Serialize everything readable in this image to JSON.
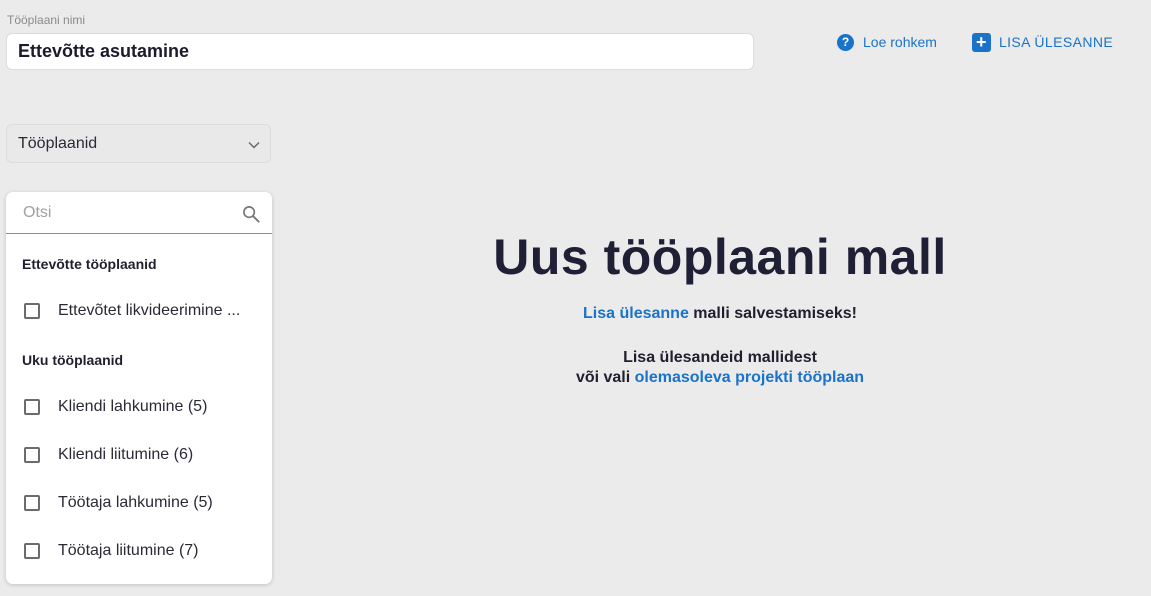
{
  "plan_name": {
    "label": "Tööplaani nimi",
    "value": "Ettevõtte asutamine"
  },
  "top_actions": {
    "learn_more": "Loe rohkem",
    "learn_more_icon": "help-circle-icon",
    "add_task": "LISA ÜLESANNE",
    "add_task_icon": "plus-square-icon"
  },
  "plans_select": {
    "selected": "Tööplaanid"
  },
  "search": {
    "placeholder": "Otsi"
  },
  "groups": [
    {
      "heading": "Ettevõtte tööplaanid",
      "items": [
        {
          "label": "Ettevõtet likvideerimine ..."
        }
      ]
    },
    {
      "heading": "Uku tööplaanid",
      "items": [
        {
          "label": "Kliendi lahkumine (5)"
        },
        {
          "label": "Kliendi liitumine (6)"
        },
        {
          "label": "Töötaja lahkumine (5)"
        },
        {
          "label": "Töötaja liitumine (7)"
        }
      ]
    }
  ],
  "empty_state": {
    "title": "Uus tööplaani mall",
    "line1_link": "Lisa ülesanne",
    "line1_rest": " malli salvestamiseks!",
    "line2": "Lisa ülesandeid mallidest",
    "line3_prefix": "või vali ",
    "line3_link": "olemasoleva projekti tööplaan"
  },
  "colors": {
    "accent": "#1a73c9",
    "background": "#ebebeb"
  }
}
